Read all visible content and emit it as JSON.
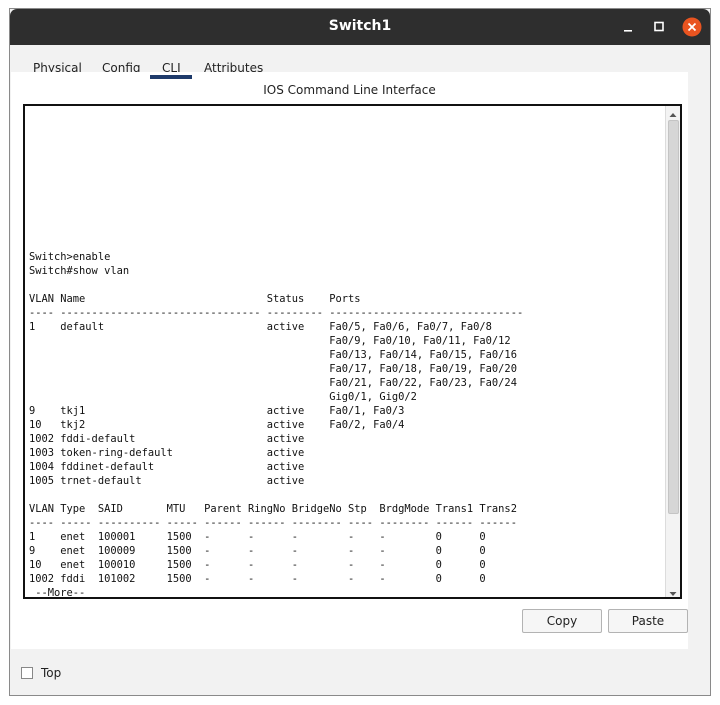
{
  "window": {
    "title": "Switch1",
    "controls": [
      {
        "name": "minimize",
        "icon": "minimize-icon"
      },
      {
        "name": "maximize",
        "icon": "maximize-icon"
      },
      {
        "name": "close",
        "icon": "close-icon",
        "color": "#e95420"
      }
    ]
  },
  "tabs": [
    {
      "label": "Physical",
      "active": false
    },
    {
      "label": "Config",
      "active": false
    },
    {
      "label": "CLI",
      "active": true
    },
    {
      "label": "Attributes",
      "active": false
    }
  ],
  "panel": {
    "caption": "IOS Command Line Interface"
  },
  "terminal": {
    "lines": [
      "",
      "",
      "",
      "",
      "",
      "",
      "",
      "",
      "",
      "",
      "Switch>enable",
      "Switch#show vlan",
      "",
      "VLAN Name                             Status    Ports",
      "---- -------------------------------- --------- -------------------------------",
      "1    default                          active    Fa0/5, Fa0/6, Fa0/7, Fa0/8",
      "                                                Fa0/9, Fa0/10, Fa0/11, Fa0/12",
      "                                                Fa0/13, Fa0/14, Fa0/15, Fa0/16",
      "                                                Fa0/17, Fa0/18, Fa0/19, Fa0/20",
      "                                                Fa0/21, Fa0/22, Fa0/23, Fa0/24",
      "                                                Gig0/1, Gig0/2",
      "9    tkj1                             active    Fa0/1, Fa0/3",
      "10   tkj2                             active    Fa0/2, Fa0/4",
      "1002 fddi-default                     active",
      "1003 token-ring-default               active",
      "1004 fddinet-default                  active",
      "1005 trnet-default                    active",
      "",
      "VLAN Type  SAID       MTU   Parent RingNo BridgeNo Stp  BrdgMode Trans1 Trans2",
      "---- ----- ---------- ----- ------ ------ -------- ---- -------- ------ ------",
      "1    enet  100001     1500  -      -      -        -    -        0      0",
      "9    enet  100009     1500  -      -      -        -    -        0      0",
      "10   enet  100010     1500  -      -      -        -    -        0      0",
      "1002 fddi  101002     1500  -      -      -        -    -        0      0",
      " --More--"
    ],
    "scrollbar": {
      "up_icon": "scroll-up-arrow-icon",
      "down_icon": "scroll-down-arrow-icon"
    }
  },
  "buttons": {
    "copy": "Copy",
    "paste": "Paste"
  },
  "footer": {
    "top_label": "Top",
    "top_checked": false
  }
}
